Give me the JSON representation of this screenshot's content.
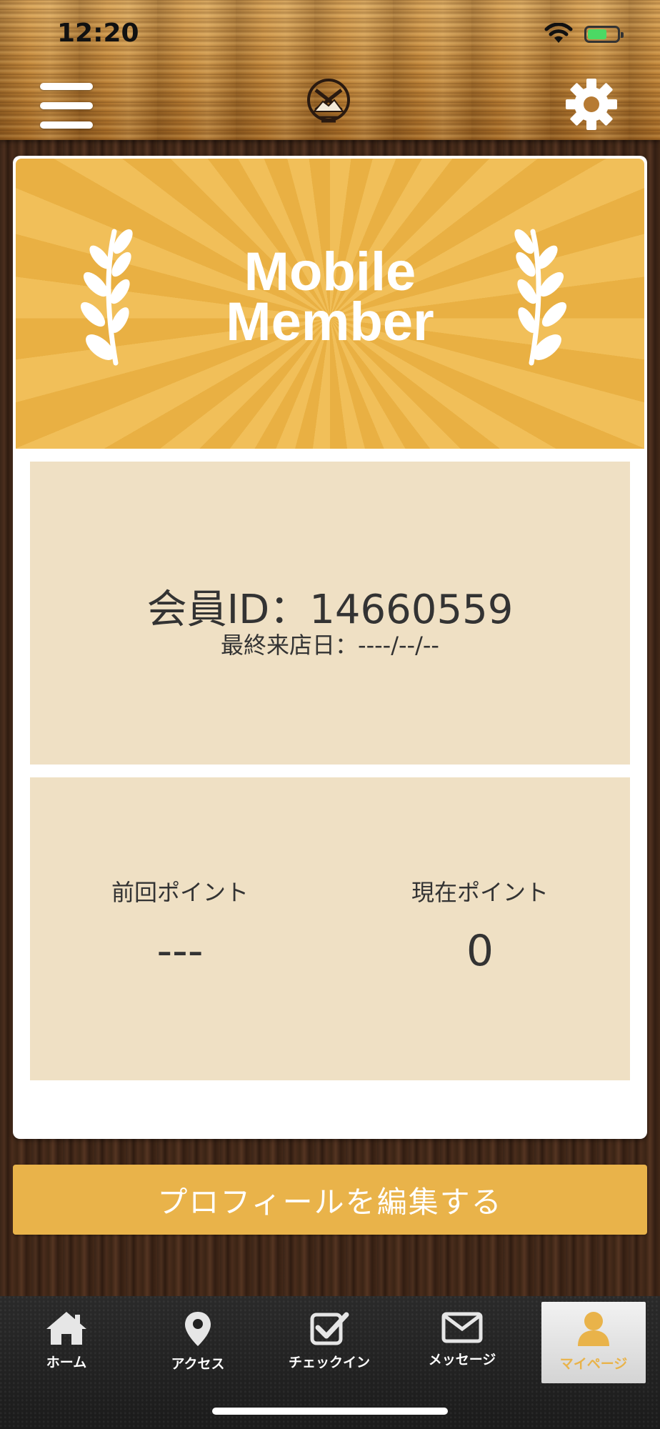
{
  "status_bar": {
    "time": "12:20"
  },
  "header": {
    "menu_icon": "hamburger-menu-icon",
    "logo_icon": "shop-logo-icon",
    "settings_icon": "gear-icon"
  },
  "member_card": {
    "banner_title_line1": "Mobile",
    "banner_title_line2": "Member",
    "member_id": "会員ID：14660559",
    "last_visit": "最終来店日：----/--/--",
    "previous_points_label": "前回ポイント",
    "previous_points_value": "---",
    "current_points_label": "現在ポイント",
    "current_points_value": "0"
  },
  "edit_profile_label": "プロフィールを編集する",
  "colors": {
    "accent": "#e9b34a",
    "panel": "#efe0c4",
    "banner_light": "#f1bf59",
    "banner_dark": "#e9b043"
  },
  "tabs": [
    {
      "label": "ホーム",
      "icon": "home-icon",
      "active": false
    },
    {
      "label": "アクセス",
      "icon": "map-pin-icon",
      "active": false
    },
    {
      "label": "チェックイン",
      "icon": "checkbox-icon",
      "active": false
    },
    {
      "label": "メッセージ",
      "icon": "envelope-icon",
      "active": false
    },
    {
      "label": "マイページ",
      "icon": "user-icon",
      "active": true
    }
  ]
}
